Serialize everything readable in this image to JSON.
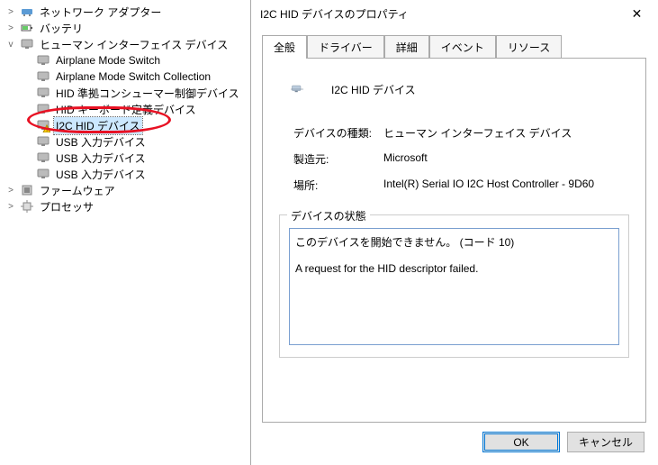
{
  "tree": {
    "root_items": [
      {
        "label": "ネットワーク アダプター",
        "expand": ">",
        "icon": "net"
      },
      {
        "label": "バッテリ",
        "expand": ">",
        "icon": "bat"
      }
    ],
    "hid_label": "ヒューマン インターフェイス デバイス",
    "hid_expand": "v",
    "hid_children": [
      {
        "label": "Airplane Mode Switch"
      },
      {
        "label": "Airplane Mode Switch Collection"
      },
      {
        "label": "HID 準拠コンシューマー制御デバイス"
      },
      {
        "label": "HID キーボード定義デバイス"
      },
      {
        "label": "I2C HID デバイス",
        "warn": true,
        "selected": true
      },
      {
        "label": "USB 入力デバイス"
      },
      {
        "label": "USB 入力デバイス"
      },
      {
        "label": "USB 入力デバイス"
      }
    ],
    "tail_items": [
      {
        "label": "ファームウェア",
        "expand": ">",
        "icon": "fw"
      },
      {
        "label": "プロセッサ",
        "expand": ">",
        "icon": "cpu"
      }
    ]
  },
  "dialog": {
    "title": "I2C HID デバイスのプロパティ",
    "tabs": [
      "全般",
      "ドライバー",
      "詳細",
      "イベント",
      "リソース"
    ],
    "active_tab": 0,
    "device_name": "I2C HID デバイス",
    "rows": {
      "type_k": "デバイスの種類:",
      "type_v": "ヒューマン インターフェイス デバイス",
      "mfr_k": "製造元:",
      "mfr_v": "Microsoft",
      "loc_k": "場所:",
      "loc_v": "Intel(R) Serial IO I2C Host Controller - 9D60"
    },
    "status_legend": "デバイスの状態",
    "status_text": "このデバイスを開始できません。 (コード 10)\n\nA request for the HID descriptor failed.",
    "ok": "OK",
    "cancel": "キャンセル"
  }
}
